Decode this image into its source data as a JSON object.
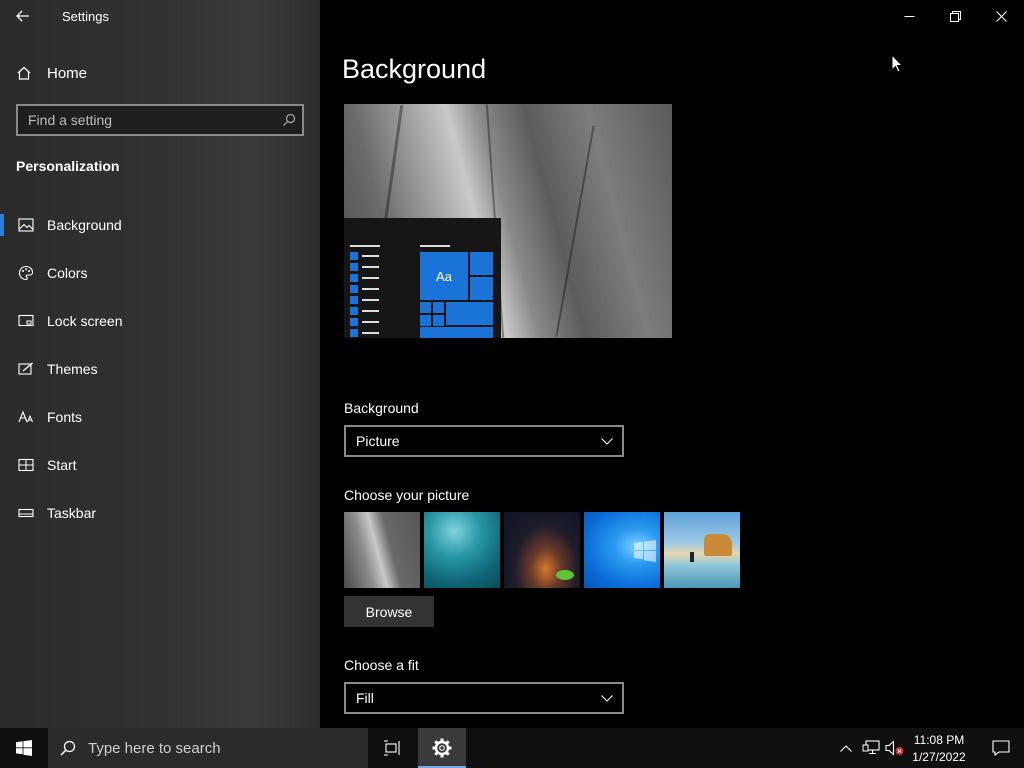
{
  "window": {
    "title": "Settings"
  },
  "nav": {
    "home_label": "Home",
    "search_placeholder": "Find a setting",
    "section_title": "Personalization",
    "items": [
      {
        "label": "Background",
        "icon": "image-icon",
        "active": true
      },
      {
        "label": "Colors",
        "icon": "palette-icon",
        "active": false
      },
      {
        "label": "Lock screen",
        "icon": "lock-screen-icon",
        "active": false
      },
      {
        "label": "Themes",
        "icon": "themes-icon",
        "active": false
      },
      {
        "label": "Fonts",
        "icon": "fonts-icon",
        "active": false
      },
      {
        "label": "Start",
        "icon": "start-icon",
        "active": false
      },
      {
        "label": "Taskbar",
        "icon": "taskbar-icon",
        "active": false
      }
    ]
  },
  "main": {
    "page_title": "Background",
    "preview_tile_text": "Aa",
    "background_label": "Background",
    "background_value": "Picture",
    "choose_picture_label": "Choose your picture",
    "browse_label": "Browse",
    "fit_label": "Choose a fit",
    "fit_value": "Fill"
  },
  "taskbar": {
    "search_placeholder": "Type here to search",
    "time": "11:08 PM",
    "date": "1/27/2022"
  },
  "colors": {
    "accent": "#1a73d6",
    "active_indicator": "#2f7ee0"
  }
}
